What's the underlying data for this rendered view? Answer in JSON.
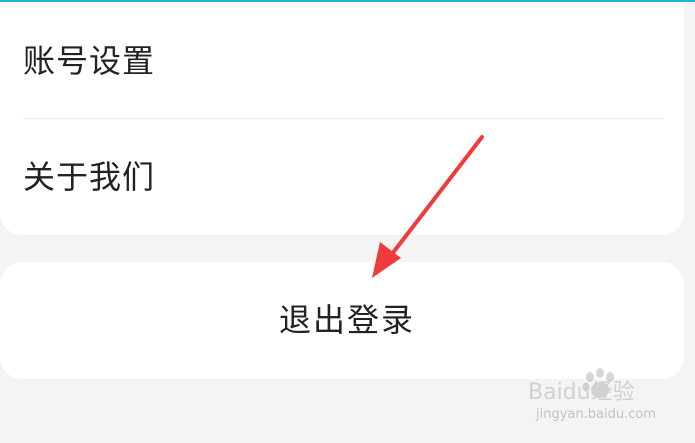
{
  "colors": {
    "page_background": "#f4f4f6",
    "card_background": "#ffffff",
    "top_accent": "#1fb4d8",
    "text": "#222222",
    "divider": "#ececec",
    "arrow": "#ef3b3b"
  },
  "settings": {
    "items": [
      {
        "label": "账号设置"
      },
      {
        "label": "关于我们"
      }
    ]
  },
  "logout": {
    "label": "退出登录"
  },
  "annotation": {
    "arrow_color": "#ef3b3b"
  },
  "watermark": {
    "logo_text": "Baidu经验",
    "domain": "jingyan.baidu.com"
  }
}
